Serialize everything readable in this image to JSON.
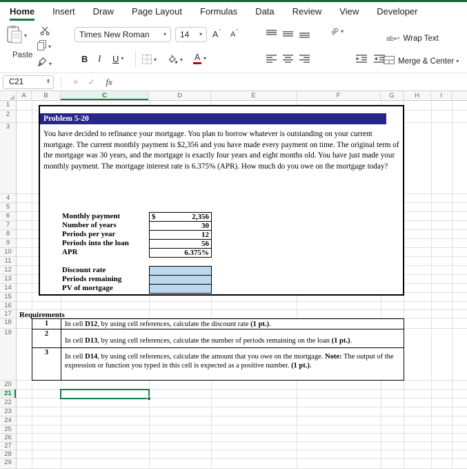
{
  "tabs": {
    "items": [
      "Home",
      "Insert",
      "Draw",
      "Page Layout",
      "Formulas",
      "Data",
      "Review",
      "View",
      "Developer"
    ],
    "active": "Home"
  },
  "ribbon": {
    "paste": "Paste",
    "font_name": "Times New Roman",
    "font_size": "14",
    "bold": "B",
    "italic": "I",
    "underline": "U",
    "grow_font": "A",
    "shrink_font": "A",
    "font_color_letter": "A",
    "orientation_glyph": "ab",
    "wrap_glyph": "ab",
    "wrap_arrow": "↩",
    "wrap_text": "Wrap Text",
    "merge_center": "Merge & Center"
  },
  "formula_bar": {
    "name_box": "C21",
    "cancel": "×",
    "enter": "✓",
    "fx": "fx"
  },
  "icons": {
    "chevron": "▾",
    "spin_up": "▲",
    "spin_down": "▼",
    "grow_mark": "ˆ",
    "shrink_mark": "ˇ"
  },
  "grid": {
    "col_headers": [
      "A",
      "B",
      "C",
      "D",
      "E",
      "F",
      "G",
      "H",
      "I",
      ""
    ],
    "row_count": 29,
    "selected_cell": "C21",
    "selected_col": "C",
    "selected_row": 21
  },
  "sheet": {
    "title": "Problem 5-20",
    "problem_text": "You have decided to refinance your mortgage. You plan to borrow whatever is outstanding on your current mortgage. The current monthly payment is $2,356 and you have made every payment on time. The original term of the mortgage was 30 years, and the mortgage is exactly four years and eight months old. You have just made your monthly payment. The mortgage interest rate is 6.375% (APR). How much do you owe on the mortgage today?",
    "given": [
      {
        "label": "Monthly payment",
        "prefix": "$",
        "value": "2,356"
      },
      {
        "label": "Number of years",
        "prefix": "",
        "value": "30"
      },
      {
        "label": "Periods per year",
        "prefix": "",
        "value": "12"
      },
      {
        "label": "Periods into the loan",
        "prefix": "",
        "value": "56"
      },
      {
        "label": "APR",
        "prefix": "",
        "value": "6.375%"
      }
    ],
    "outputs": [
      {
        "label": "Discount rate"
      },
      {
        "label": "Periods remaining"
      },
      {
        "label": "PV of mortgage"
      }
    ],
    "requirements_heading": "Requirements",
    "requirements": [
      {
        "num": "1",
        "segments": [
          {
            "text": "In cell ",
            "bold": false
          },
          {
            "text": "D12",
            "bold": true
          },
          {
            "text": ", by using cell references, calculate the discount rate ",
            "bold": false
          },
          {
            "text": "(1 pt.)",
            "bold": true
          },
          {
            "text": ".",
            "bold": false
          }
        ]
      },
      {
        "num": "2",
        "segments": [
          {
            "text": "In cell ",
            "bold": false
          },
          {
            "text": "D13",
            "bold": true
          },
          {
            "text": ", by using cell references, calculate the number of periods remaining on the loan ",
            "bold": false
          },
          {
            "text": "(1 pt.)",
            "bold": true
          },
          {
            "text": ".",
            "bold": false
          }
        ]
      },
      {
        "num": "3",
        "segments": [
          {
            "text": "In cell ",
            "bold": false
          },
          {
            "text": "D14",
            "bold": true
          },
          {
            "text": ", by using cell references, calculate the amount that you owe on the mortgage.  ",
            "bold": false
          },
          {
            "text": "Note:",
            "bold": true
          },
          {
            "text": " The output of the expression or function you typed in this cell is expected as a positive number. ",
            "bold": false
          },
          {
            "text": "(1 pt.)",
            "bold": true
          },
          {
            "text": ".",
            "bold": false
          }
        ]
      }
    ]
  },
  "colors": {
    "excel_green": "#107C41",
    "top_strip": "#17643A",
    "title_bar": "#26268B",
    "input_fill": "#BDD7EE",
    "font_color_indicator": "#C00000"
  }
}
